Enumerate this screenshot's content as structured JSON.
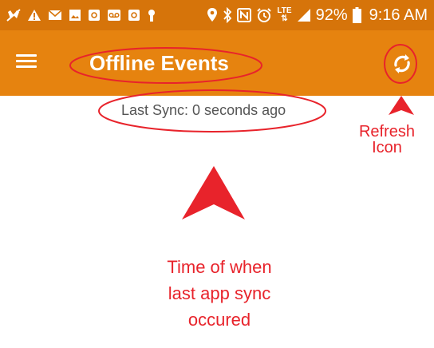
{
  "status_bar": {
    "battery_percent": "92%",
    "time": "9:16 AM",
    "network_label": "LTE"
  },
  "toolbar": {
    "title": "Offline Events",
    "menu_icon": "hamburger-menu-icon",
    "refresh_icon": "refresh-icon"
  },
  "content": {
    "last_sync": "Last Sync: 0 seconds ago"
  },
  "annotations": {
    "refresh_label_line1": "Refresh",
    "refresh_label_line2": "Icon",
    "sync_label_line1": "Time of when",
    "sync_label_line2": "last app sync",
    "sync_label_line3": "occured"
  },
  "colors": {
    "status_bar": "#d6740a",
    "toolbar": "#e6830f",
    "annotation_red": "#e8232b",
    "sync_text": "#555555"
  }
}
